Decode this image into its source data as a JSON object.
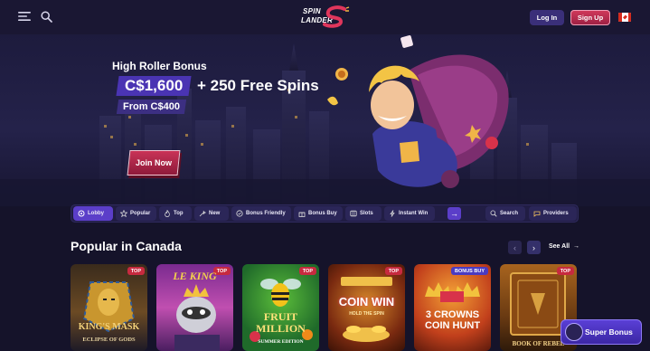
{
  "header": {
    "logo_line1": "SPIN",
    "logo_line2": "LANDER",
    "login_label": "Log In",
    "signup_label": "Sign Up"
  },
  "hero": {
    "eyebrow": "High Roller Bonus",
    "amount": "C$1,600",
    "spins": "+ 250 Free Spins",
    "from": "From C$400",
    "cta": "Join Now"
  },
  "categories": [
    {
      "label": "Lobby",
      "icon": "lobby-icon",
      "active": true
    },
    {
      "label": "Popular",
      "icon": "star-icon"
    },
    {
      "label": "Top",
      "icon": "flame-icon"
    },
    {
      "label": "New",
      "icon": "sparkle-icon"
    },
    {
      "label": "Bonus Friendly",
      "icon": "bonus-icon"
    },
    {
      "label": "Bonus Buy",
      "icon": "gift-icon"
    },
    {
      "label": "Slots",
      "icon": "slot-icon"
    },
    {
      "label": "Instant Win",
      "icon": "lightning-icon"
    },
    {
      "label": "Search",
      "icon": "search-icon"
    },
    {
      "label": "Providers",
      "icon": "providers-icon"
    }
  ],
  "popular": {
    "title": "Popular in Canada",
    "see_all": "See All",
    "games": [
      {
        "title": "KING'S MASK",
        "subtitle": "ECLIPSE OF GODS",
        "badge": "TOP"
      },
      {
        "title": "LE KING",
        "subtitle": "",
        "badge": "TOP"
      },
      {
        "title": "FRUIT MILLION",
        "subtitle": "SUMMER EDITION",
        "badge": "TOP"
      },
      {
        "title": "COIN WIN",
        "subtitle": "HOLD THE SPIN",
        "badge": "TOP"
      },
      {
        "title": "3 CROWNS COIN HUNT",
        "subtitle": "",
        "badge": "BONUS BUY"
      },
      {
        "title": "BOOK OF REBEL",
        "subtitle": "",
        "badge": "TOP"
      }
    ]
  },
  "super_bonus_label": "Super Bonus",
  "colors": {
    "background": "#15132a",
    "accent_purple": "#5b3ec9",
    "signup_red": "#c93357"
  }
}
